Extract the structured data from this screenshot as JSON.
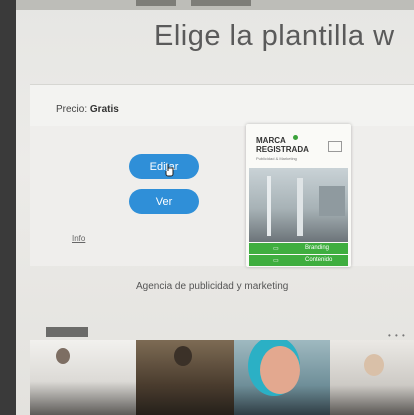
{
  "page": {
    "title": "Elige la plantilla w"
  },
  "price": {
    "label": "Precio:",
    "value": "Gratis"
  },
  "actions": {
    "edit_label": "Editar",
    "view_label": "Ver",
    "info_label": "Info"
  },
  "template": {
    "brand_line1": "MARCA",
    "brand_line2": "REGISTRADA",
    "brand_sub": "Publicidad & Marketing",
    "row1": "Branding",
    "row2": "Contenido",
    "caption": "Agencia de publicidad y marketing"
  },
  "colors": {
    "button": "#2f8fd8",
    "accent_green": "#3fae3f"
  }
}
